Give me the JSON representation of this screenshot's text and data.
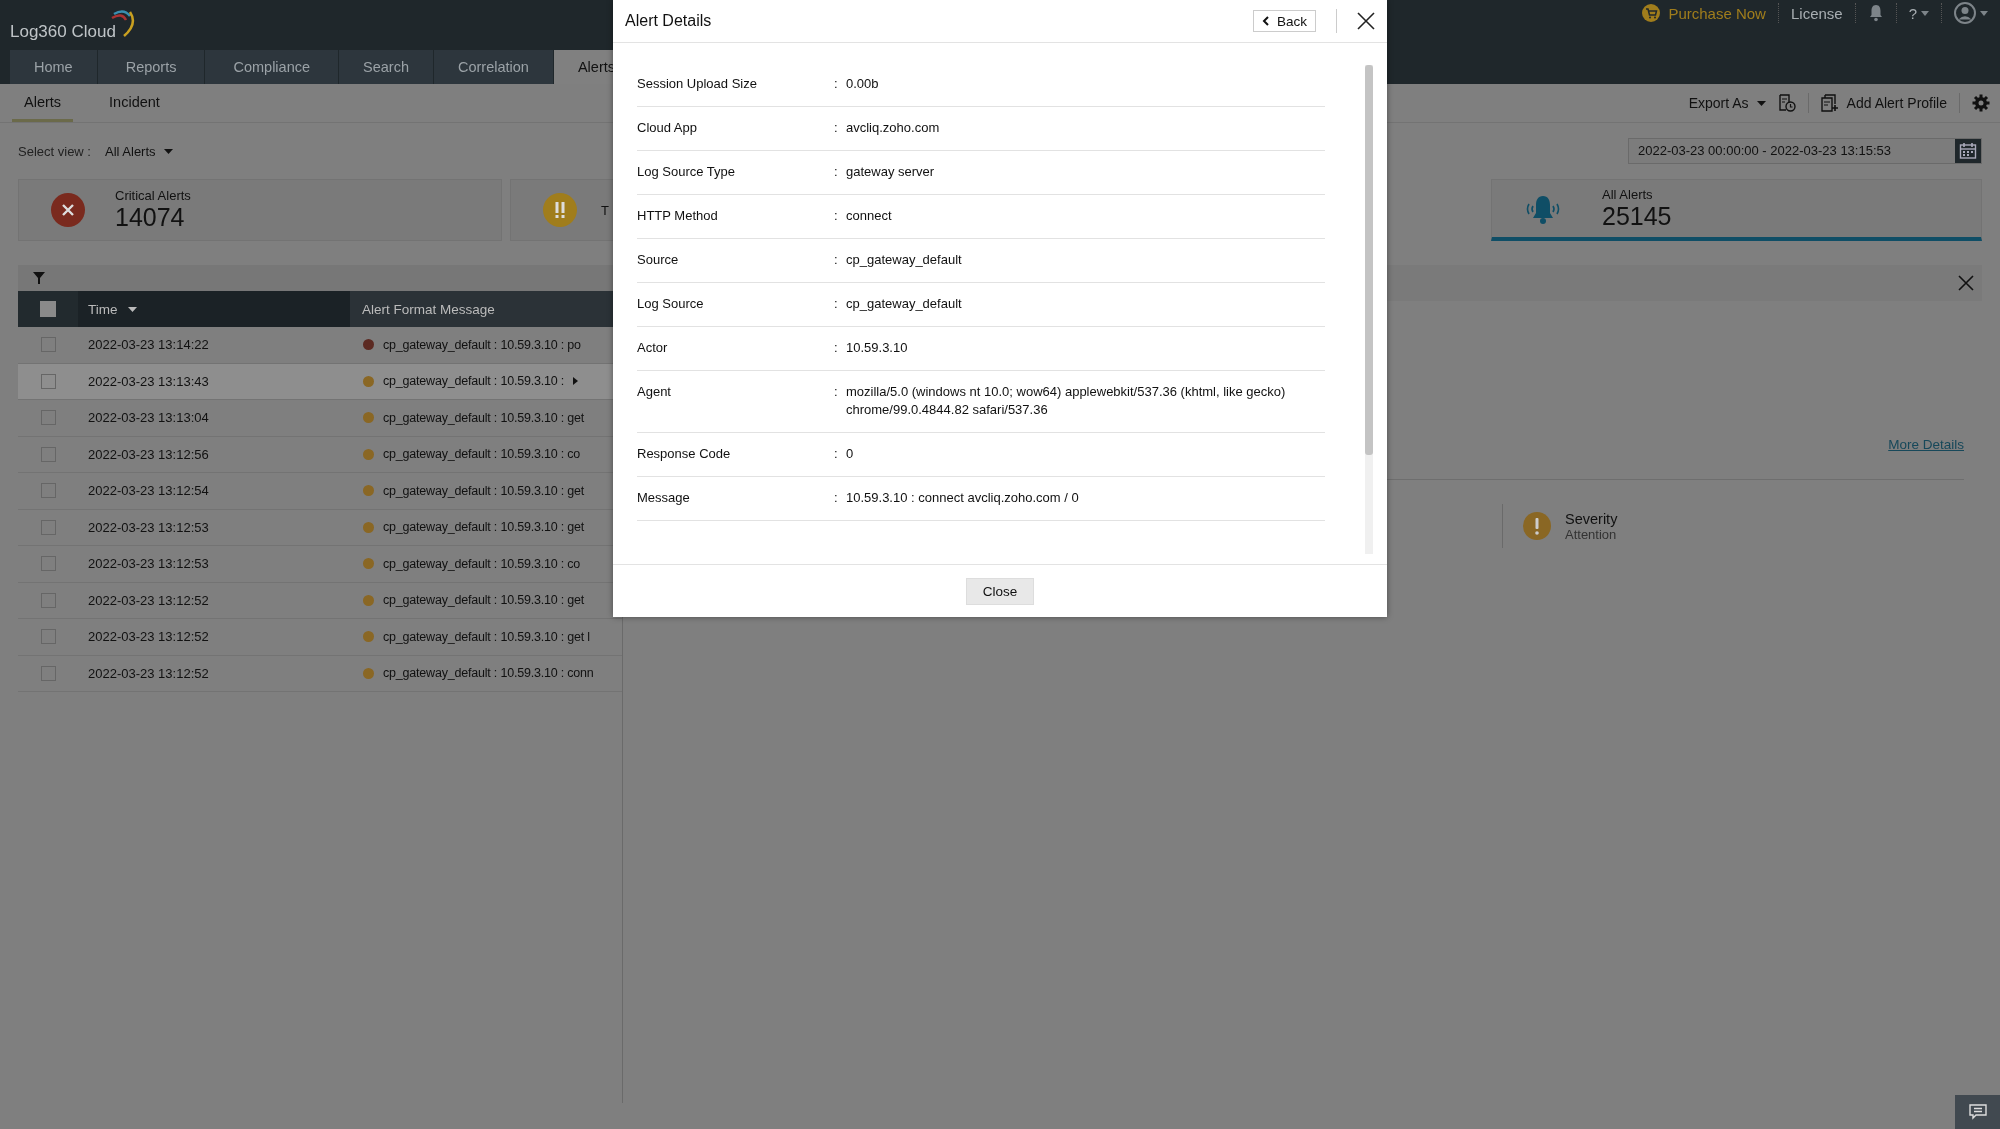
{
  "app": {
    "logo": "Log360 Cloud"
  },
  "top_links": {
    "purchase": "Purchase Now",
    "license": "License",
    "help": "?"
  },
  "nav_tabs": [
    {
      "label": "Home",
      "selected": false
    },
    {
      "label": "Reports",
      "selected": false
    },
    {
      "label": "Compliance",
      "selected": false
    },
    {
      "label": "Search",
      "selected": false
    },
    {
      "label": "Correlation",
      "selected": false
    },
    {
      "label": "Alerts",
      "selected": true
    }
  ],
  "sub_tabs": [
    {
      "label": "Alerts",
      "selected": true
    },
    {
      "label": "Incident",
      "selected": false
    }
  ],
  "toolbar": {
    "export": "Export As",
    "add_profile": "Add Alert Profile"
  },
  "view": {
    "label": "Select view :",
    "value": "All Alerts"
  },
  "date_range": {
    "value": "2022-03-23 00:00:00 - 2022-03-23 13:15:53"
  },
  "summary_cards": [
    {
      "kind": "critical",
      "title": "Critical Alerts",
      "count": "14074",
      "selected": false
    },
    {
      "kind": "trouble",
      "title": "T",
      "selected": false
    },
    {
      "kind": "all",
      "title": "All Alerts",
      "count": "25145",
      "selected": true
    }
  ],
  "table": {
    "columns": [
      "Time",
      "Alert Format Message"
    ],
    "select_all": {
      "checked": false
    },
    "rows": [
      {
        "time": "2022-03-23 13:14:22",
        "message": "cp_gateway_default : 10.59.3.10 : po",
        "color": "#5c2a22",
        "checked": false,
        "selected": false,
        "more": false
      },
      {
        "time": "2022-03-23 13:13:43",
        "message": "cp_gateway_default : 10.59.3.10 :",
        "color": "#8a6724",
        "checked": false,
        "selected": true,
        "more": true
      },
      {
        "time": "2022-03-23 13:13:04",
        "message": "cp_gateway_default : 10.59.3.10 : get",
        "color": "#8a6724",
        "checked": false,
        "selected": false,
        "more": false
      },
      {
        "time": "2022-03-23 13:12:56",
        "message": "cp_gateway_default : 10.59.3.10 : co",
        "color": "#8a6724",
        "checked": false,
        "selected": false,
        "more": false
      },
      {
        "time": "2022-03-23 13:12:54",
        "message": "cp_gateway_default : 10.59.3.10 : get",
        "color": "#8a6724",
        "checked": false,
        "selected": false,
        "more": false
      },
      {
        "time": "2022-03-23 13:12:53",
        "message": "cp_gateway_default : 10.59.3.10 : get",
        "color": "#8a6724",
        "checked": false,
        "selected": false,
        "more": false
      },
      {
        "time": "2022-03-23 13:12:53",
        "message": "cp_gateway_default : 10.59.3.10 : co",
        "color": "#8a6724",
        "checked": false,
        "selected": false,
        "more": false
      },
      {
        "time": "2022-03-23 13:12:52",
        "message": "cp_gateway_default : 10.59.3.10 : get",
        "color": "#8a6724",
        "checked": false,
        "selected": false,
        "more": false
      },
      {
        "time": "2022-03-23 13:12:52",
        "message": "cp_gateway_default : 10.59.3.10 : get l",
        "color": "#8a6724",
        "checked": false,
        "selected": false,
        "more": false
      },
      {
        "time": "2022-03-23 13:12:52",
        "message": "cp_gateway_default : 10.59.3.10 : conn",
        "color": "#8a6724",
        "checked": false,
        "selected": false,
        "more": false
      }
    ]
  },
  "detail_panel": {
    "link": "More Details",
    "severity": {
      "label": "Severity",
      "value": "Attention"
    }
  },
  "modal": {
    "title": "Alert Details",
    "back": "Back",
    "close": "Close",
    "separator": ":",
    "fields": [
      {
        "label": "Session Upload Size",
        "value": "0.00b"
      },
      {
        "label": "Cloud App",
        "value": "avcliq.zoho.com"
      },
      {
        "label": "Log Source Type",
        "value": "gateway server"
      },
      {
        "label": "HTTP Method",
        "value": "connect"
      },
      {
        "label": "Source",
        "value": "cp_gateway_default"
      },
      {
        "label": "Log Source",
        "value": "cp_gateway_default"
      },
      {
        "label": "Actor",
        "value": "10.59.3.10"
      },
      {
        "label": "Agent",
        "value": "mozilla/5.0 (windows nt 10.0; wow64) applewebkit/537.36 (khtml, like gecko) chrome/99.0.4844.82 safari/537.36"
      },
      {
        "label": "Response Code",
        "value": "0"
      },
      {
        "label": "Message",
        "value": "10.59.3.10 : connect avcliq.zoho.com / 0"
      }
    ]
  }
}
